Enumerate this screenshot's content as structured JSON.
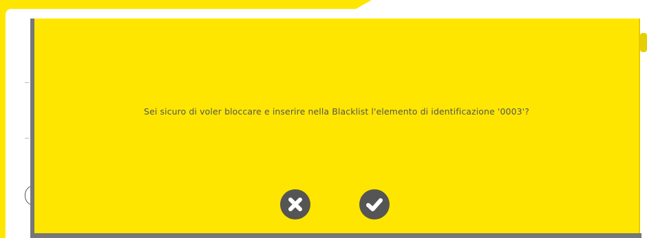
{
  "dialog": {
    "message": "Sei sicuro di voler bloccare e inserire nella Blacklist l'elemento di identificazione '0003'?",
    "cancel_icon": "close-icon",
    "confirm_icon": "check-icon"
  },
  "colors": {
    "background": "#ffe600",
    "modal": "#ffe600",
    "text": "#555555",
    "button": "#555555",
    "button_icon": "#ffffff"
  }
}
